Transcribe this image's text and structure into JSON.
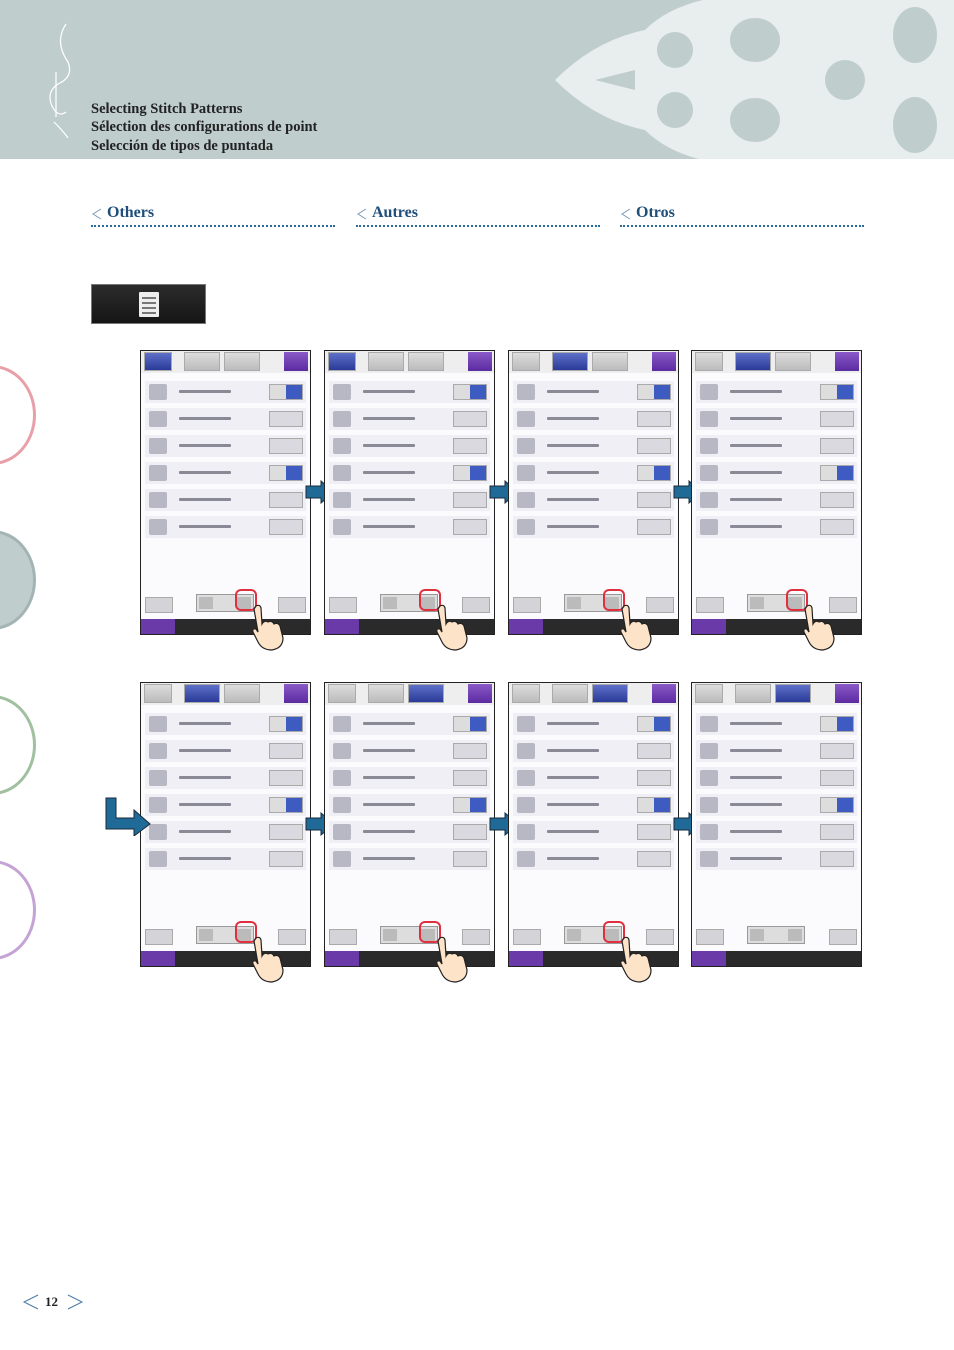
{
  "header": {
    "titles": [
      "Selecting Stitch Patterns",
      "Sélection des configurations de point",
      "Selección de tipos de puntada"
    ]
  },
  "sections": [
    {
      "label": "Others"
    },
    {
      "label": "Autres"
    },
    {
      "label": "Otros"
    }
  ],
  "settings_button": {
    "icon": "settings-page-icon"
  },
  "side_tabs": [
    {
      "color": "#e8a0a8"
    },
    {
      "color": "#a4b4b4",
      "active": true
    },
    {
      "color": "#a0c0a0"
    },
    {
      "color": "#c4a4d4"
    }
  ],
  "screens": [
    {
      "step": 1,
      "active_tab": 0,
      "next_highlighted": true
    },
    {
      "step": 2,
      "active_tab": 0,
      "next_highlighted": true
    },
    {
      "step": 3,
      "active_tab": 1,
      "next_highlighted": true
    },
    {
      "step": 4,
      "active_tab": 1,
      "next_highlighted": true
    },
    {
      "step": 5,
      "active_tab": 1,
      "next_highlighted": true
    },
    {
      "step": 6,
      "active_tab": 2,
      "next_highlighted": true
    },
    {
      "step": 7,
      "active_tab": 2,
      "next_highlighted": true
    },
    {
      "step": 8,
      "active_tab": 2,
      "next_highlighted": false
    }
  ],
  "colors": {
    "header_bg": "#c0cdcd",
    "section_title": "#1f4e79",
    "arrow": "#1f6a96",
    "highlight": "#e03040"
  },
  "footer": {
    "page_number": "12"
  }
}
